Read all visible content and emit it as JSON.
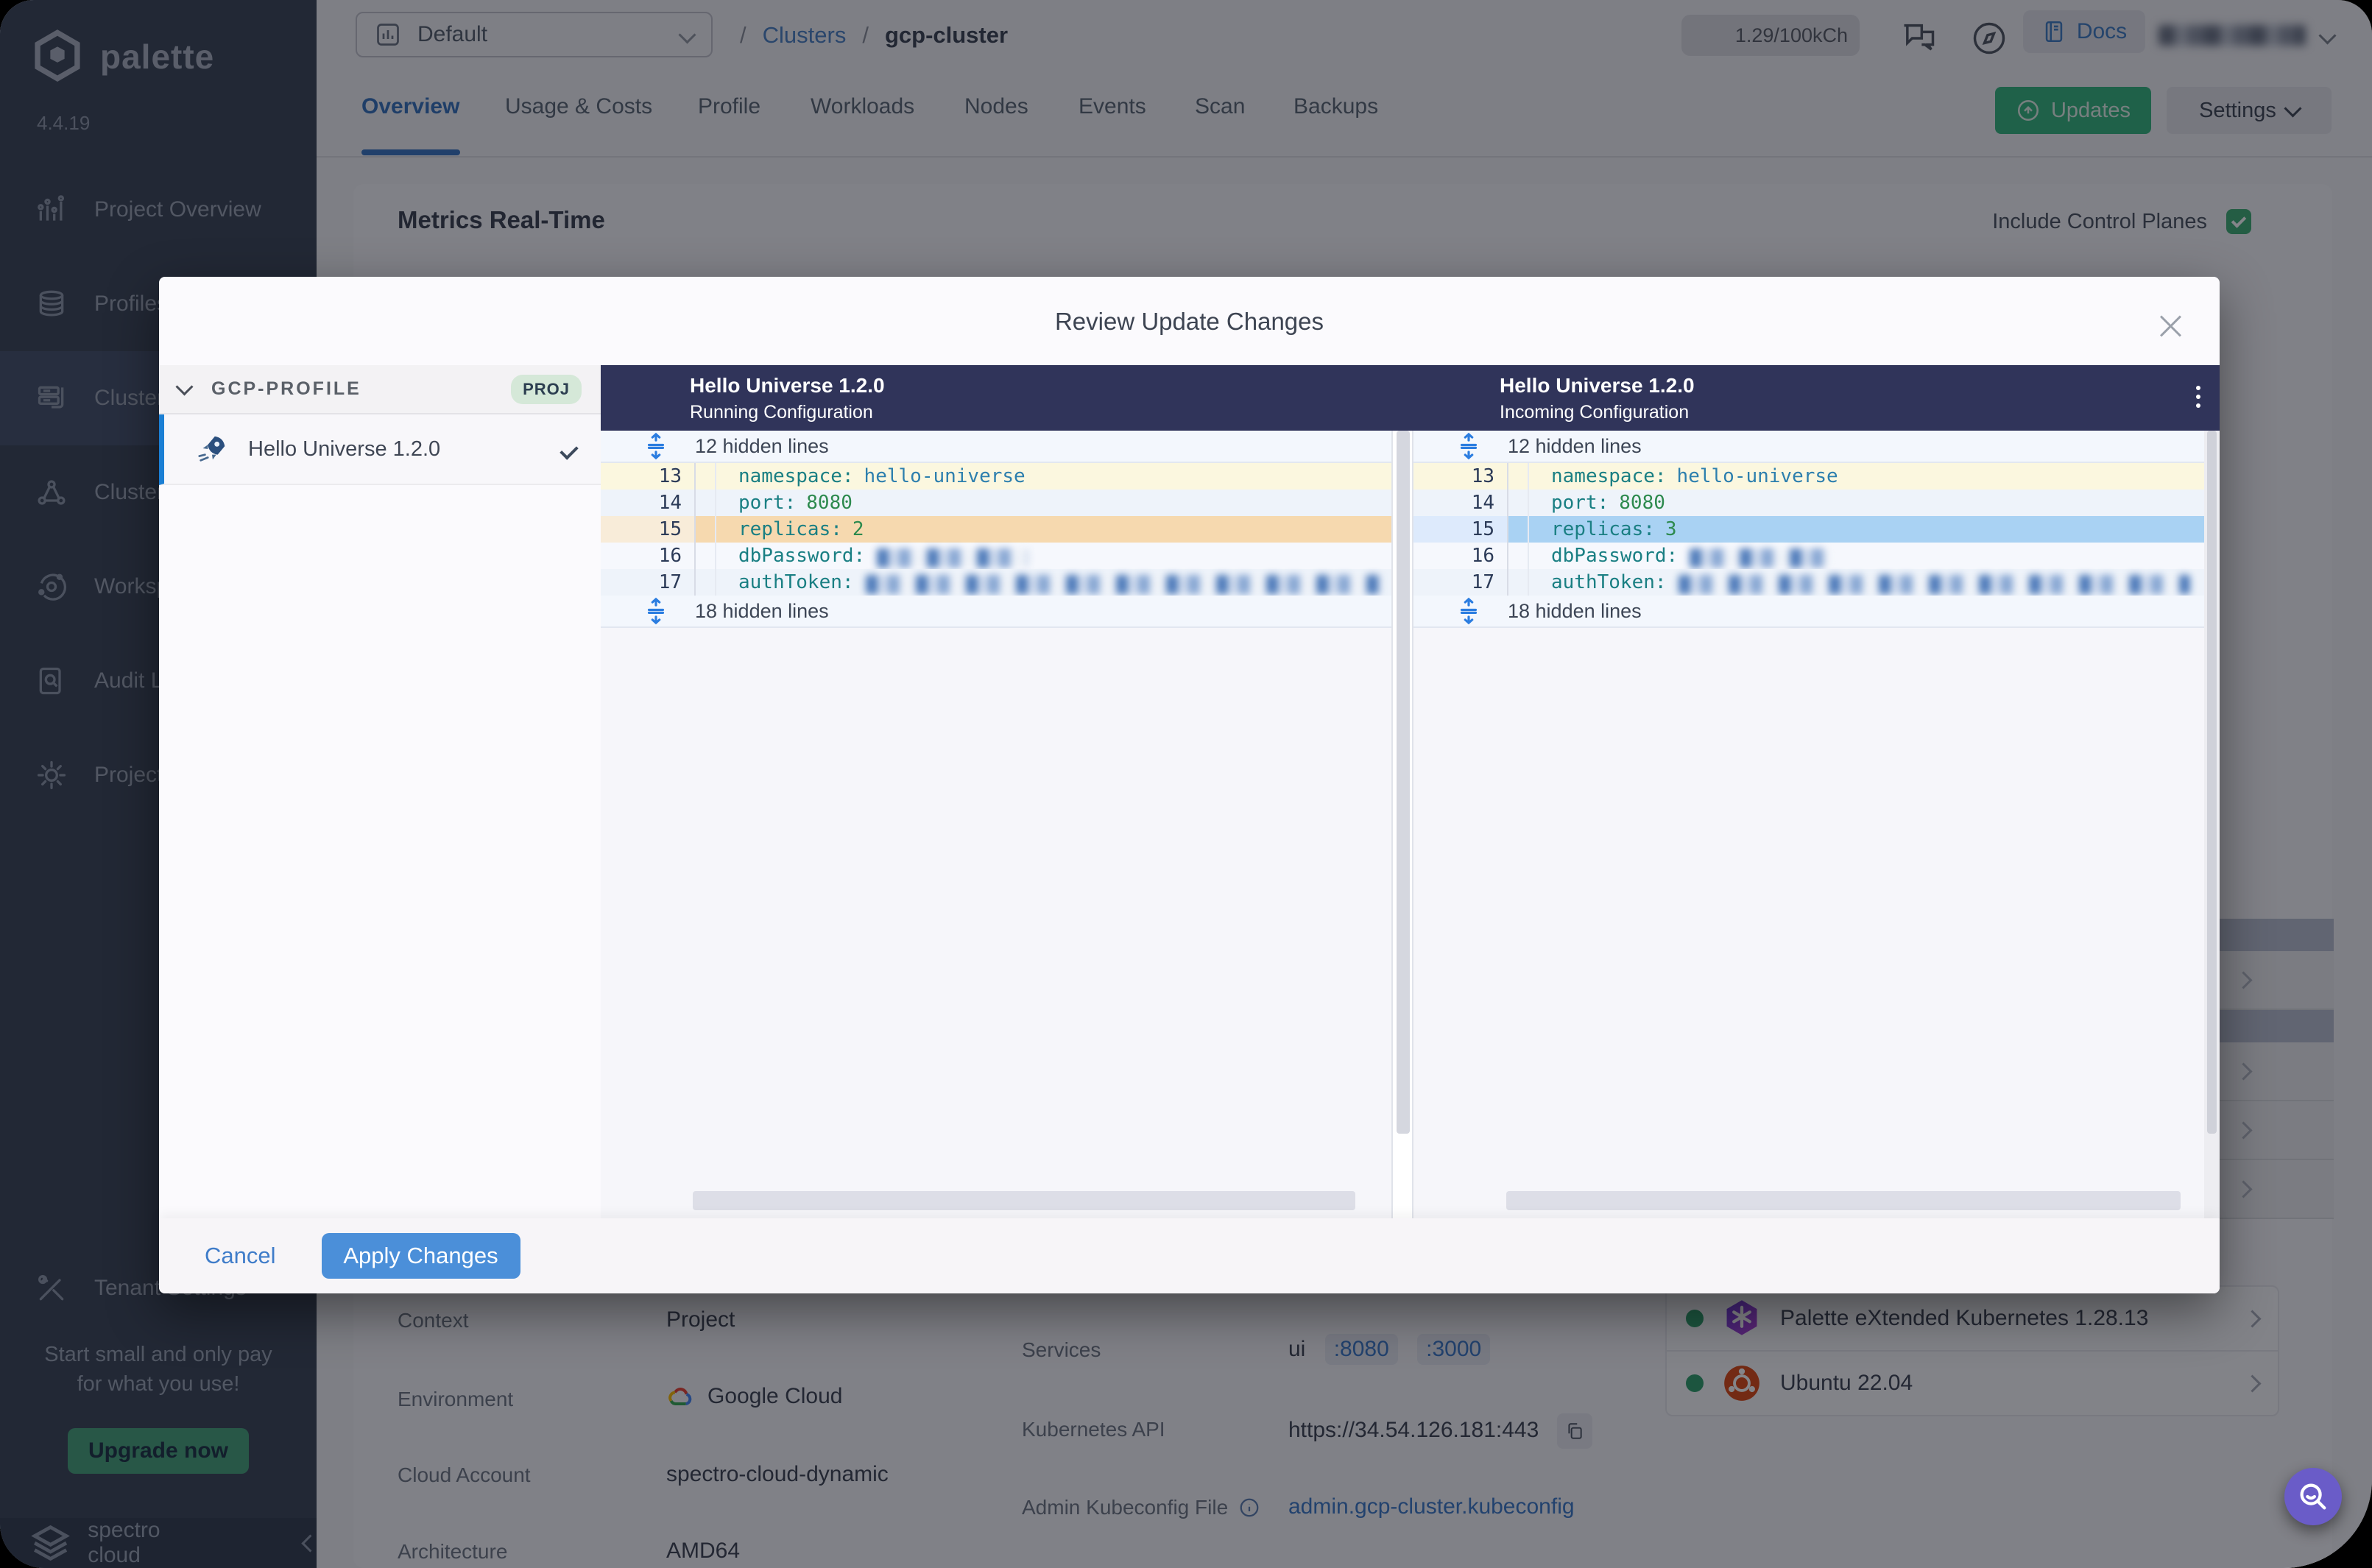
{
  "app": {
    "brand": "palette",
    "version": "4.4.19",
    "footer_brand": "spectro cloud"
  },
  "sidebar": {
    "items": [
      {
        "label": "Project Overview"
      },
      {
        "label": "Profiles"
      },
      {
        "label": "Clusters"
      },
      {
        "label": "Cluster Groups"
      },
      {
        "label": "Workspaces"
      },
      {
        "label": "Audit Logs"
      },
      {
        "label": "Project Settings"
      }
    ],
    "tenant": "Tenant Settings",
    "promo": {
      "line1": "Start small and only pay",
      "line2": "for what you use!",
      "button": "Upgrade now"
    }
  },
  "topbar": {
    "project": "Default",
    "separator": "/",
    "breadcrumb_link": "Clusters",
    "breadcrumb_current": "gcp-cluster",
    "credits": "1.29/100kCh",
    "docs": "Docs"
  },
  "tabs": {
    "items": [
      {
        "label": "Overview"
      },
      {
        "label": "Usage & Costs"
      },
      {
        "label": "Profile"
      },
      {
        "label": "Workloads"
      },
      {
        "label": "Nodes"
      },
      {
        "label": "Events"
      },
      {
        "label": "Scan"
      },
      {
        "label": "Backups"
      }
    ]
  },
  "actions": {
    "updates": "Updates",
    "settings": "Settings"
  },
  "metrics": {
    "title": "Metrics Real-Time",
    "include_label": "Include Control Planes"
  },
  "modal": {
    "title": "Review Update Changes",
    "group": "GCP-PROFILE",
    "badge": "PROJ",
    "item": "Hello Universe 1.2.0",
    "left_pane": {
      "name": "Hello Universe 1.2.0",
      "subtitle": "Running Configuration"
    },
    "right_pane": {
      "name": "Hello Universe 1.2.0",
      "subtitle": "Incoming Configuration"
    },
    "code": {
      "hidden_top": "12 hidden lines",
      "hidden_bottom": "18 hidden lines",
      "rows_left": [
        {
          "num": "13",
          "key": "namespace:",
          "value": "hello-universe"
        },
        {
          "num": "14",
          "key": "port:",
          "value": "8080"
        },
        {
          "num": "15",
          "key": "replicas:",
          "value": "2"
        },
        {
          "num": "16",
          "key": "dbPassword:"
        },
        {
          "num": "17",
          "key": "authToken:"
        }
      ],
      "rows_right": [
        {
          "num": "13",
          "key": "namespace:",
          "value": "hello-universe"
        },
        {
          "num": "14",
          "key": "port:",
          "value": "8080"
        },
        {
          "num": "15",
          "key": "replicas:",
          "value": "3"
        },
        {
          "num": "16",
          "key": "dbPassword:"
        },
        {
          "num": "17",
          "key": "authToken:"
        }
      ]
    },
    "footer": {
      "cancel": "Cancel",
      "apply": "Apply Changes"
    }
  },
  "details": {
    "rows": [
      {
        "label": "Context",
        "value": "Project"
      },
      {
        "label": "Environment",
        "value": "Google Cloud"
      },
      {
        "label": "Cloud Account",
        "value": "spectro-cloud-dynamic"
      },
      {
        "label": "Architecture",
        "value": "AMD64"
      }
    ],
    "services": {
      "label": "Services",
      "name": "ui",
      "ports": [
        ":8080",
        ":3000"
      ]
    },
    "k8s": {
      "label": "Kubernetes API",
      "value": "https://34.54.126.181:443"
    },
    "kubeconfig": {
      "label": "Admin Kubeconfig File",
      "value": "admin.gcp-cluster.kubeconfig"
    }
  },
  "packs": [
    {
      "name": "Palette eXtended Kubernetes 1.28.13"
    },
    {
      "name": "Ubuntu 22.04"
    }
  ],
  "colors": {
    "accent_blue": "#4b8fd9",
    "green": "#2e9e6b",
    "navy": "#30345a",
    "removed_bg": "#f6d9af",
    "added_bg": "#a9d2f3"
  }
}
